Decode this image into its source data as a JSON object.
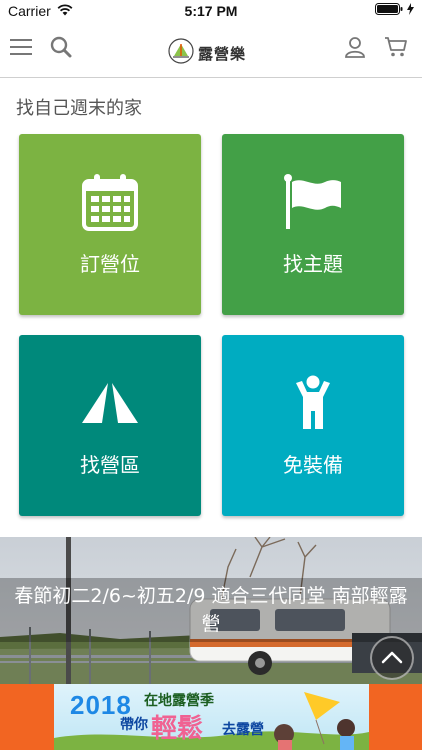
{
  "status_bar": {
    "carrier": "Carrier",
    "time": "5:17 PM"
  },
  "nav": {
    "logo_text": "露營樂"
  },
  "section": {
    "title": "找自己週末的家"
  },
  "tiles": [
    {
      "label": "訂營位",
      "icon": "calendar-icon",
      "color": "#7cb342"
    },
    {
      "label": "找主題",
      "icon": "flag-icon",
      "color": "#43a047"
    },
    {
      "label": "找營區",
      "icon": "tent-icon",
      "color": "#00897b"
    },
    {
      "label": "免裝備",
      "icon": "person-icon",
      "color": "#00acc1"
    }
  ],
  "banner": {
    "caption": "春節初二2/6~初五2/9 適合三代同堂 南部輕露營"
  },
  "ad": {
    "year": "2018",
    "line1": "在地露營季",
    "line2": "帶你",
    "big": "輕鬆",
    "line3": "去露營",
    "color": "#f26522"
  }
}
